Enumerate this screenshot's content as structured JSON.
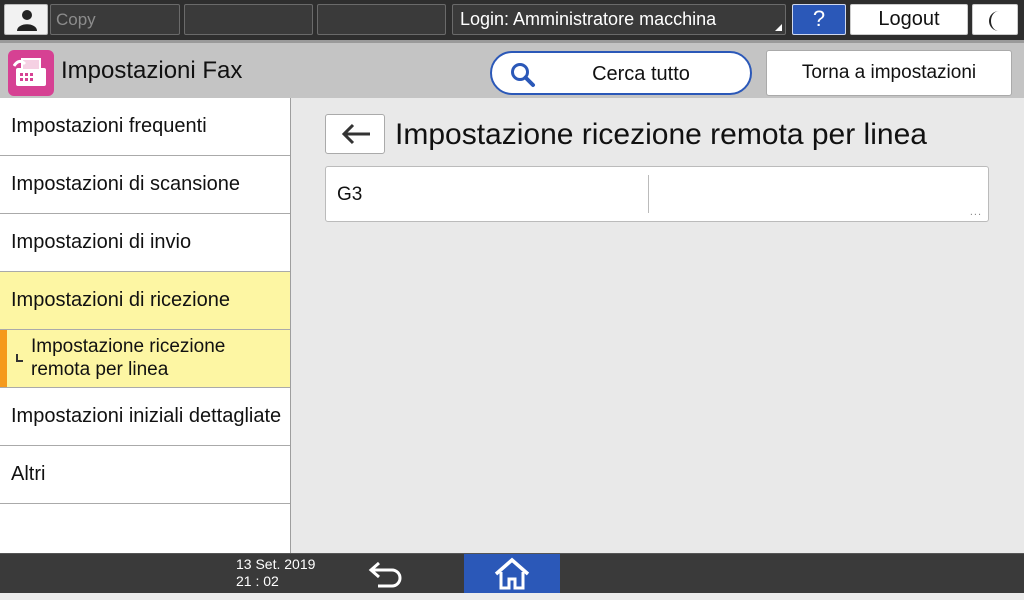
{
  "topbar": {
    "user_icon": "user-icon",
    "copy_label": "Copy",
    "login_label": "Login: Amministratore macchina",
    "help_label": "?",
    "logout_label": "Logout",
    "sleep_icon": "moon-icon"
  },
  "header": {
    "app_icon": "fax-icon",
    "title": "Impostazioni Fax",
    "search_label": "Cerca tutto",
    "back_settings_label": "Torna a impostazioni"
  },
  "sidebar": {
    "items": [
      {
        "label": "Impostazioni frequenti"
      },
      {
        "label": "Impostazioni di scansione"
      },
      {
        "label": "Impostazioni di invio"
      },
      {
        "label": "Impostazioni di ricezione"
      },
      {
        "label": "Impostazione ricezione remota per linea"
      },
      {
        "label": "Impostazioni iniziali dettagliate"
      },
      {
        "label": "Altri"
      }
    ]
  },
  "main": {
    "title": "Impostazione ricezione remota per linea",
    "rows": [
      {
        "label": "G3",
        "value": "",
        "more": "..."
      }
    ]
  },
  "bottombar": {
    "date": "13 Set. 2019",
    "time": "21 : 02"
  },
  "colors": {
    "accent_blue": "#2b58b8",
    "selected_yellow": "#fdf6a3",
    "selected_marker": "#f59a1c",
    "fax_icon_magenta": "#d64193"
  }
}
